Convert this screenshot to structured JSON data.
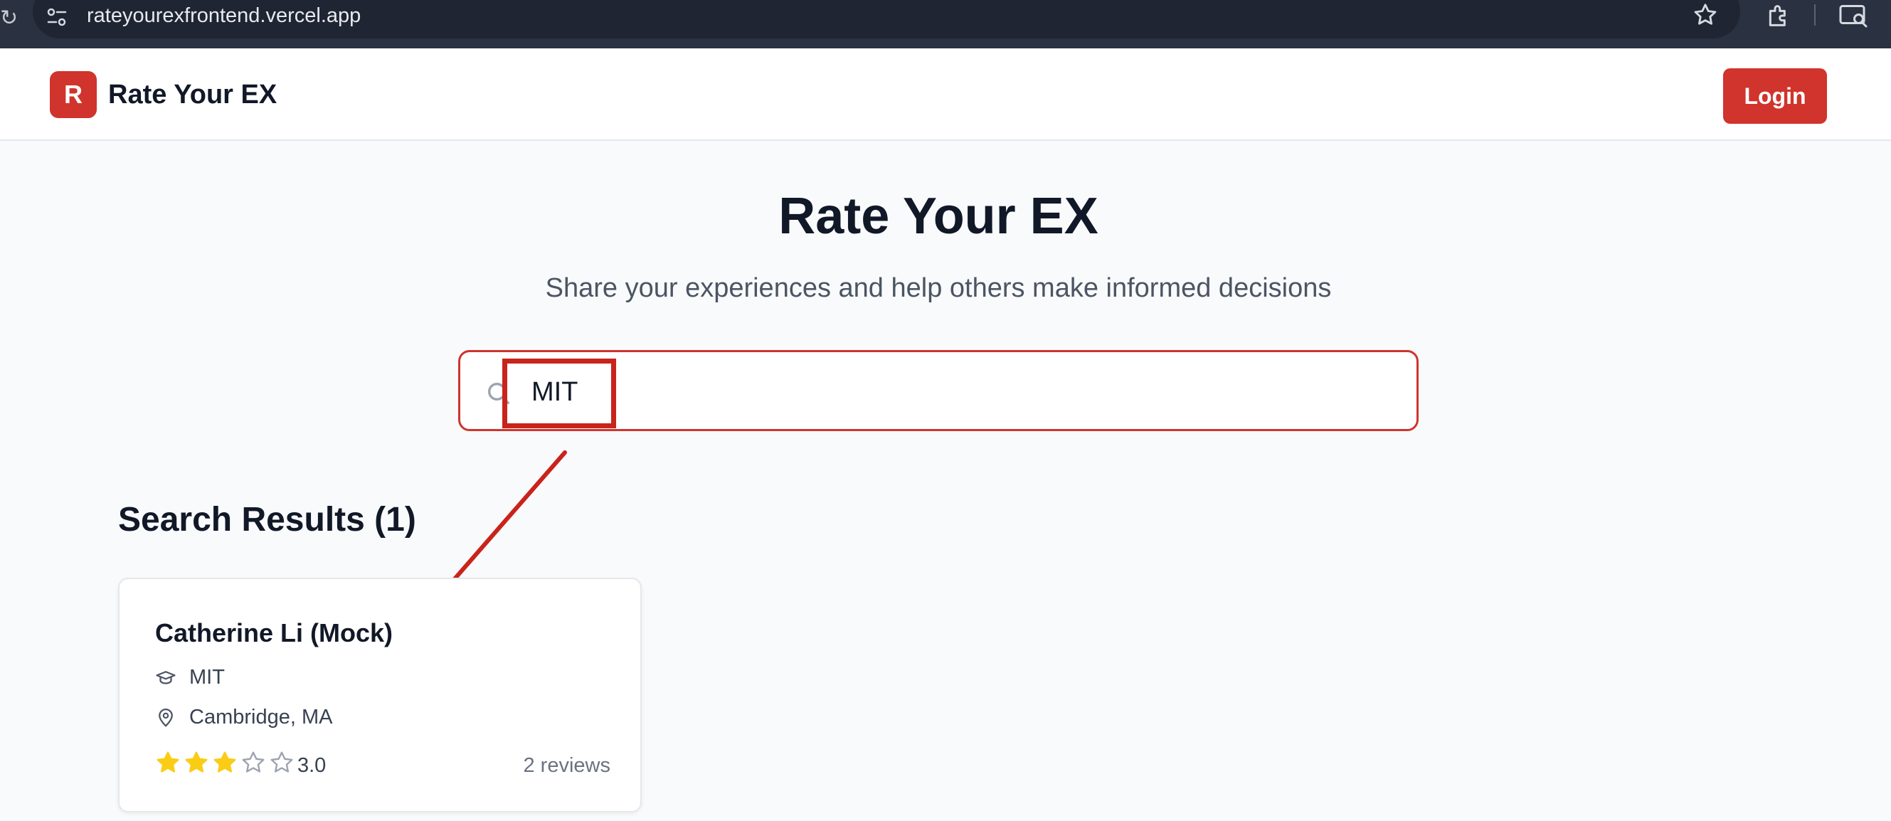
{
  "browser": {
    "url": "rateyourexfrontend.vercel.app",
    "icons": [
      "site-info-icon",
      "star-icon",
      "extensions-icon",
      "cast-icon"
    ]
  },
  "header": {
    "logo_letter": "R",
    "brand": "Rate Your EX",
    "login_label": "Login",
    "accent_color": "#d0342c"
  },
  "hero": {
    "title": "Rate Your EX",
    "subtitle": "Share your experiences and help others make informed decisions"
  },
  "search": {
    "value": "MIT"
  },
  "results": {
    "heading": "Search Results (1)",
    "items": [
      {
        "name": "Catherine Li (Mock)",
        "school": "MIT",
        "location": "Cambridge, MA",
        "rating": "3.0",
        "rating_value": 3,
        "rating_max": 5,
        "reviews": "2 reviews"
      }
    ]
  },
  "annotation": {
    "color": "#c8241c"
  }
}
